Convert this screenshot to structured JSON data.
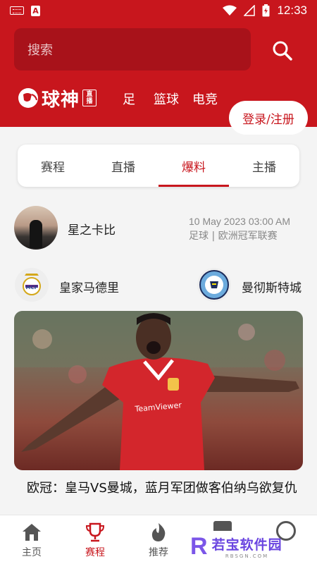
{
  "status_bar": {
    "time": "12:33"
  },
  "header": {
    "search_placeholder": "搜索",
    "logo_text": "球神",
    "logo_badge": "直播",
    "categories": [
      "足",
      "篮球",
      "电竞"
    ],
    "login_label": "登录/注册"
  },
  "tabs": [
    {
      "label": "赛程",
      "active": false
    },
    {
      "label": "直播",
      "active": false
    },
    {
      "label": "爆料",
      "active": true
    },
    {
      "label": "主播",
      "active": false
    }
  ],
  "post": {
    "author": "星之卡比",
    "date": "10 May 2023 03:00 AM",
    "competition": "足球 | 欧洲冠军联赛",
    "home_team": "皇家马德里",
    "away_team": "曼彻斯特城",
    "headline": "欧冠：皇马VS曼城，蓝月军团做客伯纳乌欲复仇",
    "jersey_text": "TeamViewer"
  },
  "bottom_nav": [
    {
      "label": "主页",
      "icon": "home-icon",
      "active": false
    },
    {
      "label": "赛程",
      "icon": "trophy-icon",
      "active": true
    },
    {
      "label": "推荐",
      "icon": "flame-icon",
      "active": false
    }
  ],
  "watermark": {
    "letter": "R",
    "main": "若宝软件园",
    "sub": "RBSGN.COM"
  },
  "colors": {
    "brand_red": "#c8161d",
    "watermark_purple": "#6a45e0"
  }
}
